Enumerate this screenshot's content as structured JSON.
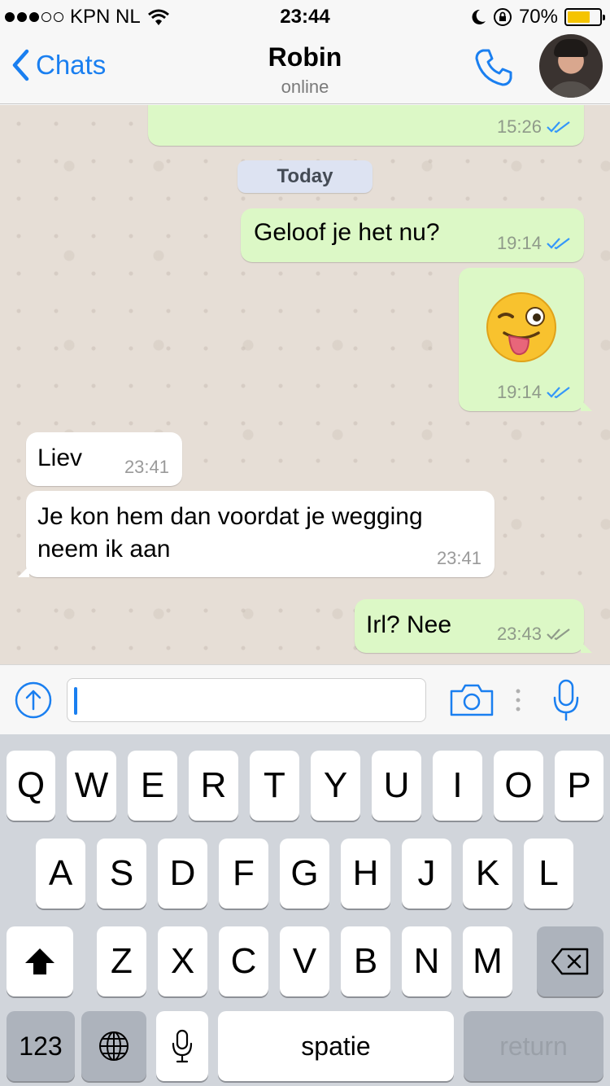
{
  "status_bar": {
    "carrier": "KPN NL",
    "time": "23:44",
    "battery_text": "70%",
    "battery_level": 0.7,
    "signal_bars_full": 3,
    "signal_bars_total": 5
  },
  "nav": {
    "back_label": "Chats",
    "contact_name": "Robin",
    "contact_status": "online"
  },
  "chat": {
    "date_separator": "Today",
    "messages": [
      {
        "direction": "out",
        "text": "",
        "time": "15:26",
        "ticks": "read"
      },
      {
        "direction": "out",
        "text": "Geloof je het nu?",
        "time": "19:14",
        "ticks": "read"
      },
      {
        "direction": "out",
        "emoji": "winking-face-with-tongue",
        "time": "19:14",
        "ticks": "read"
      },
      {
        "direction": "in",
        "text": "Liev",
        "time": "23:41"
      },
      {
        "direction": "in",
        "lines": [
          "Je kon hem dan voordat je wegging",
          "neem ik aan"
        ],
        "time": "23:41"
      },
      {
        "direction": "out",
        "text": "Irl? Nee",
        "time": "23:43",
        "ticks": "delivered"
      }
    ]
  },
  "input": {
    "value": ""
  },
  "keyboard": {
    "row1": [
      "Q",
      "W",
      "E",
      "R",
      "T",
      "Y",
      "U",
      "I",
      "O",
      "P"
    ],
    "row2": [
      "A",
      "S",
      "D",
      "F",
      "G",
      "H",
      "J",
      "K",
      "L"
    ],
    "row3": [
      "Z",
      "X",
      "C",
      "V",
      "B",
      "N",
      "M"
    ],
    "numbers_label": "123",
    "space_label": "spatie",
    "return_label": "return"
  },
  "colors": {
    "accent": "#1a7ff0",
    "outgoing_bubble": "#dcf8c6",
    "incoming_bubble": "#ffffff",
    "read_tick": "#3497f9",
    "delivered_tick": "#8f9a8a",
    "battery_fill": "#f5c400"
  }
}
